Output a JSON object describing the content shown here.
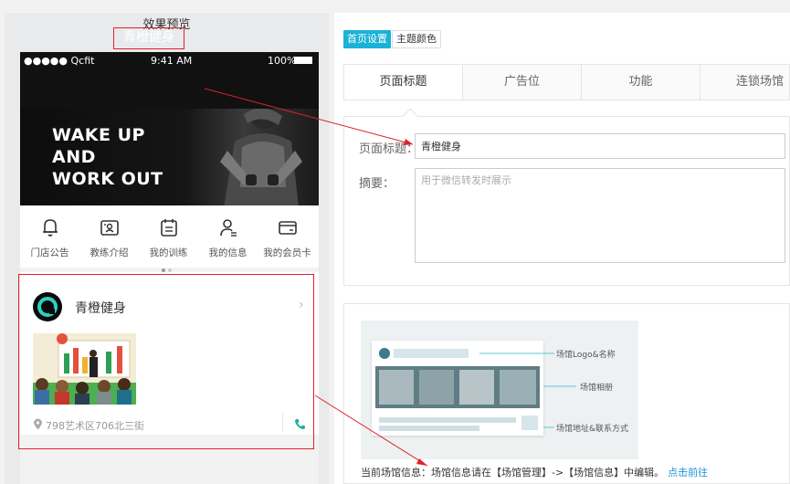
{
  "preview": {
    "title": "效果预览",
    "status_bar": {
      "carrier": "●●●●● Qcfit",
      "time": "9:41 AM",
      "battery": "100%"
    },
    "nav_title": "青橙健身",
    "banner_lines": [
      "WAKE UP",
      "AND",
      "WORK OUT"
    ],
    "features": [
      {
        "label": "门店公告",
        "icon": "bell-icon"
      },
      {
        "label": "教练介绍",
        "icon": "coach-card-icon"
      },
      {
        "label": "我的训练",
        "icon": "calendar-icon"
      },
      {
        "label": "我的信息",
        "icon": "user-icon"
      },
      {
        "label": "我的会员卡",
        "icon": "card-icon"
      }
    ],
    "venue": {
      "name": "青橙健身",
      "address": "798艺术区706北三街"
    }
  },
  "settings": {
    "top_tabs": [
      "首页设置",
      "主题颜色"
    ],
    "sub_tabs": [
      "页面标题",
      "广告位",
      "功能",
      "连锁场馆"
    ],
    "form": {
      "title_label": "页面标题：",
      "title_value": "青橙健身",
      "summary_label": "摘要：",
      "summary_placeholder": "用于微信转发时展示"
    },
    "diagram": {
      "labels": [
        "场馆Logo&名称",
        "场馆相册",
        "场馆地址&联系方式"
      ]
    },
    "info": {
      "text": "当前场馆信息：场馆信息请在【场馆管理】->【场馆信息】中编辑。",
      "link": "点击前往"
    }
  },
  "colors": {
    "accent": "#1ab2d6",
    "highlight": "#e0202a",
    "link": "#1a8fd6"
  }
}
